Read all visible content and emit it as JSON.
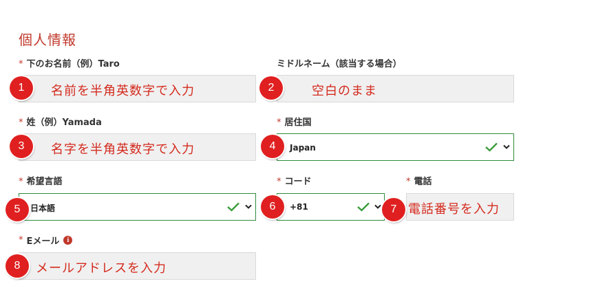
{
  "section_title": "個人情報",
  "required_mark": "*",
  "fields": {
    "first_name": {
      "label": "下のお名前（例）Taro",
      "hint": "名前を半角英数字で入力",
      "badge": "1"
    },
    "middle_name": {
      "label": "ミドルネーム（該当する場合）",
      "hint": "空白のまま",
      "badge": "2"
    },
    "last_name": {
      "label": "姓（例）Yamada",
      "hint": "名字を半角英数字で入力",
      "badge": "3"
    },
    "country": {
      "label": "居住国",
      "value": "Japan",
      "badge": "4"
    },
    "language": {
      "label": "希望言語",
      "value": "日本語",
      "badge": "5"
    },
    "code": {
      "label": "コード",
      "value": "+81",
      "badge": "6"
    },
    "phone": {
      "label": "電話",
      "hint": "電話番号を入力",
      "badge": "7"
    },
    "email": {
      "label": "Eメール",
      "hint": "メールアドレスを入力",
      "badge": "8",
      "info_icon": "i"
    }
  },
  "icons": {
    "check": "check-icon",
    "chevron": "chevron-down-icon",
    "info": "info-icon"
  },
  "colors": {
    "accent_red": "#c0392b",
    "badge_red": "#e02020",
    "valid_green": "#2e8b3a"
  }
}
